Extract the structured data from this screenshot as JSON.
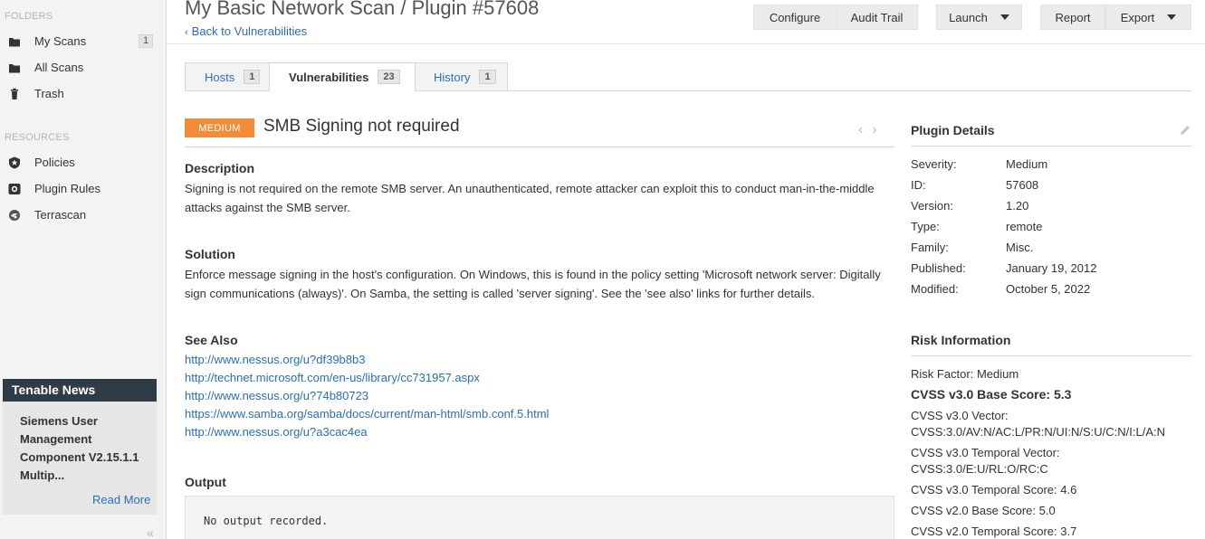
{
  "sidebar": {
    "folders_heading": "FOLDERS",
    "folders": [
      {
        "label": "My Scans",
        "count": "1",
        "icon": "folder-icon"
      },
      {
        "label": "All Scans",
        "icon": "folder-icon"
      },
      {
        "label": "Trash",
        "icon": "trash-icon"
      }
    ],
    "resources_heading": "RESOURCES",
    "resources": [
      {
        "label": "Policies",
        "icon": "shield-icon"
      },
      {
        "label": "Plugin Rules",
        "icon": "plugin-rules-icon"
      },
      {
        "label": "Terrascan",
        "icon": "terrascan-icon"
      }
    ],
    "news": {
      "heading": "Tenable News",
      "title": "Siemens User Management Component V2.15.1.1 Multip...",
      "read_more": "Read More"
    }
  },
  "header": {
    "title": "My Basic Network Scan / Plugin #57608",
    "back_link": "Back to Vulnerabilities",
    "buttons": {
      "configure": "Configure",
      "audit_trail": "Audit Trail",
      "launch": "Launch",
      "report": "Report",
      "export": "Export"
    }
  },
  "tabs": [
    {
      "label": "Hosts",
      "count": "1"
    },
    {
      "label": "Vulnerabilities",
      "count": "23"
    },
    {
      "label": "History",
      "count": "1"
    }
  ],
  "vulnerability": {
    "severity": "MEDIUM",
    "severity_color": "#f28c38",
    "name": "SMB Signing not required",
    "description_heading": "Description",
    "description": "Signing is not required on the remote SMB server. An unauthenticated, remote attacker can exploit this to conduct man-in-the-middle attacks against the SMB server.",
    "solution_heading": "Solution",
    "solution": "Enforce message signing in the host's configuration. On Windows, this is found in the policy setting 'Microsoft network server: Digitally sign communications (always)'. On Samba, the setting is called 'server signing'. See the 'see also' links for further details.",
    "see_also_heading": "See Also",
    "see_also": [
      "http://www.nessus.org/u?df39b8b3",
      "http://technet.microsoft.com/en-us/library/cc731957.aspx",
      "http://www.nessus.org/u?74b80723",
      "https://www.samba.org/samba/docs/current/man-html/smb.conf.5.html",
      "http://www.nessus.org/u?a3cac4ea"
    ],
    "output_heading": "Output",
    "output": "No output recorded."
  },
  "plugin_details": {
    "heading": "Plugin Details",
    "rows": [
      {
        "key": "Severity:",
        "value": "Medium"
      },
      {
        "key": "ID:",
        "value": "57608"
      },
      {
        "key": "Version:",
        "value": "1.20"
      },
      {
        "key": "Type:",
        "value": "remote"
      },
      {
        "key": "Family:",
        "value": "Misc."
      },
      {
        "key": "Published:",
        "value": "January 19, 2012"
      },
      {
        "key": "Modified:",
        "value": "October 5, 2022"
      }
    ]
  },
  "risk_information": {
    "heading": "Risk Information",
    "risk_factor": "Risk Factor: Medium",
    "cvss3_base": "CVSS v3.0 Base Score: 5.3",
    "cvss3_vector_label": "CVSS v3.0 Vector:",
    "cvss3_vector": "CVSS:3.0/AV:N/AC:L/PR:N/UI:N/S:U/C:N/I:L/A:N",
    "cvss3_temporal_vector_label": "CVSS v3.0 Temporal Vector:",
    "cvss3_temporal_vector": "CVSS:3.0/E:U/RL:O/RC:C",
    "cvss3_temporal_score": "CVSS v3.0 Temporal Score: 4.6",
    "cvss2_base": "CVSS v2.0 Base Score: 5.0",
    "cvss2_temporal": "CVSS v2.0 Temporal Score: 3.7"
  }
}
